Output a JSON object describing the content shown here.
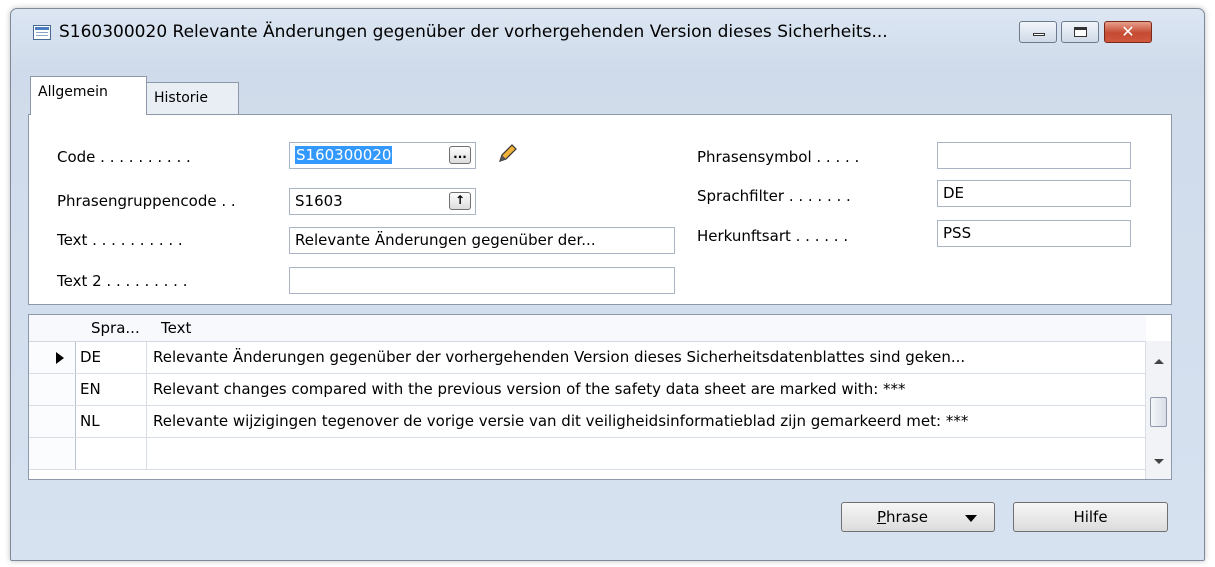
{
  "window": {
    "title": "S160300020 Relevante Änderungen gegenüber der vorhergehenden Version dieses Sicherheits...",
    "close_glyph": "✕"
  },
  "tabs": [
    {
      "label": "Allgemein",
      "active": true
    },
    {
      "label": "Historie",
      "active": false
    }
  ],
  "form": {
    "code": {
      "label": "Code . . . . . . . . . .",
      "value": "S160300020"
    },
    "phrasengruppencode": {
      "label": "Phrasengruppencode . .",
      "value": "S1603"
    },
    "text": {
      "label": "Text . . . . . . . . . .",
      "value": "Relevante Änderungen gegenüber der..."
    },
    "text2": {
      "label": "Text 2 . . . . . . . . .",
      "value": ""
    },
    "phrasensymbol": {
      "label": "Phrasensymbol . . . . .",
      "value": ""
    },
    "sprachfilter": {
      "label": "Sprachfilter . . . . . . .",
      "value": "DE"
    },
    "herkunftsart": {
      "label": "Herkunftsart . . . . . .",
      "value": "PSS"
    },
    "lookup_button": "...",
    "drilldown_button": "↑"
  },
  "grid": {
    "columns": [
      "Spra...",
      "Text"
    ],
    "rows": [
      {
        "lang": "DE",
        "text": "Relevante Änderungen gegenüber der vorhergehenden Version dieses Sicherheitsdatenblattes sind geken...",
        "current": true
      },
      {
        "lang": "EN",
        "text": "Relevant changes compared with the previous version of the safety data sheet are marked with: ***",
        "current": false
      },
      {
        "lang": "NL",
        "text": "Relevante wijzigingen tegenover de vorige versie van dit veiligheidsinformatieblad zijn gemarkeerd met: ***",
        "current": false
      },
      {
        "lang": "",
        "text": "",
        "current": false
      }
    ]
  },
  "buttons": {
    "phrase_underlined": "P",
    "phrase_rest": "hrase",
    "hilfe": "Hilfe"
  }
}
